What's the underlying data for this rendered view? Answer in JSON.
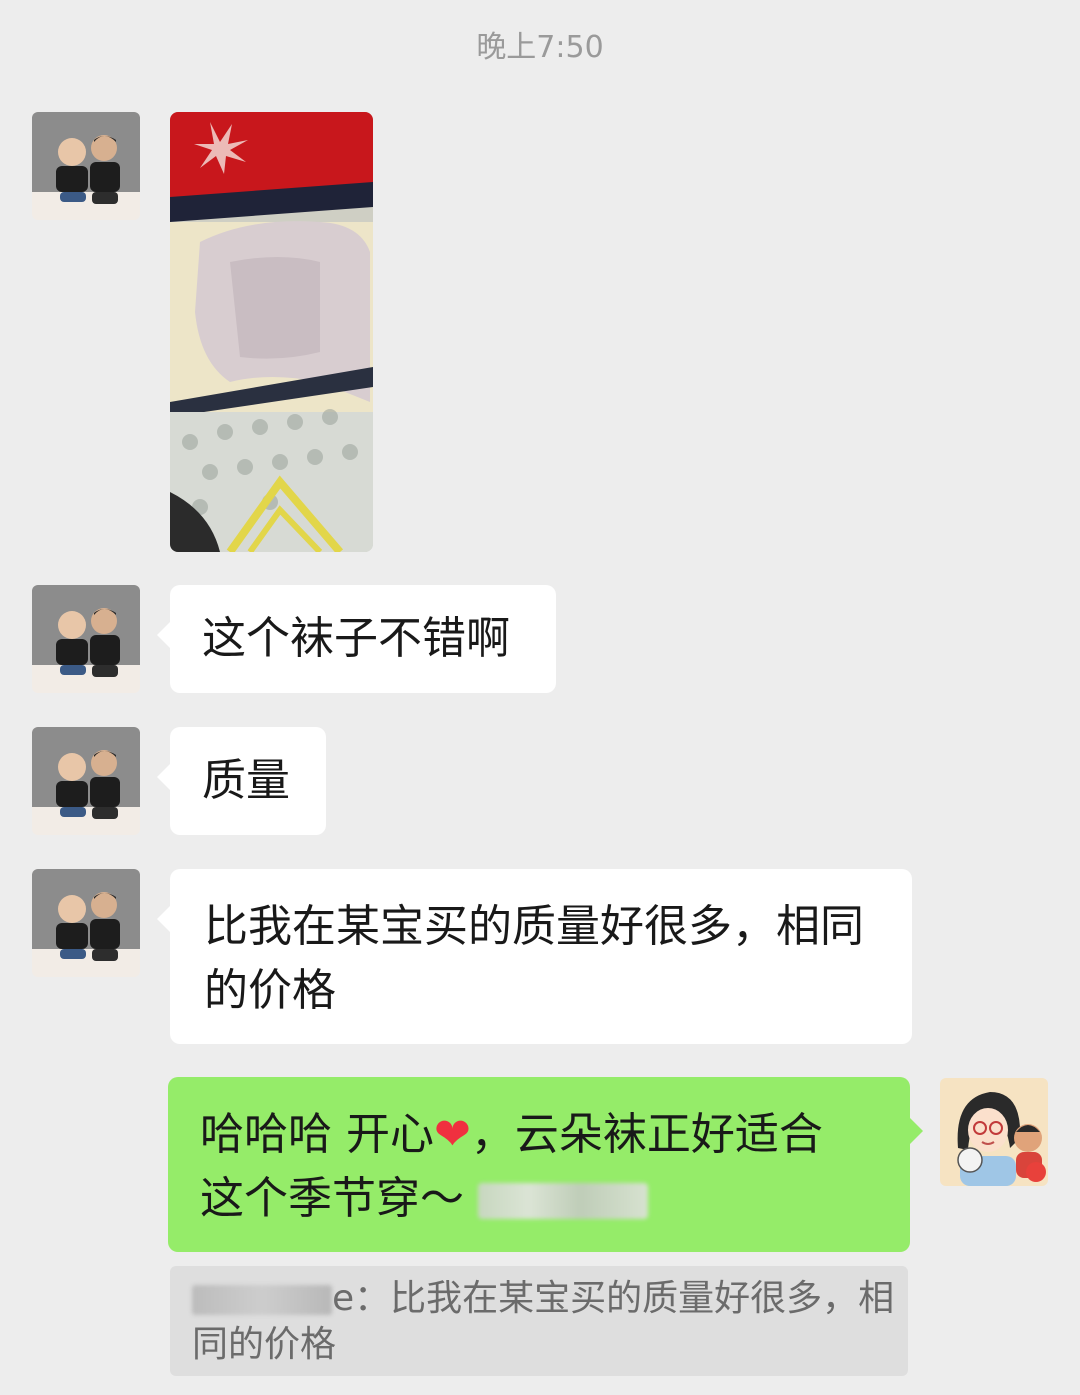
{
  "timestamp": "晚上7:50",
  "contact": {
    "avatar_icon": "two-kids-photo-icon"
  },
  "me": {
    "avatar_icon": "cartoon-woman-with-kid-icon"
  },
  "messages": [
    {
      "type": "image",
      "from": "contact",
      "photo_icon": "socks-photo-icon"
    },
    {
      "type": "text",
      "from": "contact",
      "text": "这个袜子不错啊"
    },
    {
      "type": "text",
      "from": "contact",
      "text": "质量"
    },
    {
      "type": "text",
      "from": "contact",
      "line1": "比我在某宝买的质量好很多，相同",
      "line2": "的价格"
    },
    {
      "type": "text",
      "from": "me",
      "part1": "哈哈哈 开心",
      "heart": "❤",
      "part2": "，云朵袜正好适合",
      "line2": "这个季节穿～"
    }
  ],
  "quote": {
    "suffix": "e：比我在某宝买的质量好很多，相",
    "line2": "同的价格"
  },
  "colors": {
    "background": "#ededed",
    "incoming_bubble": "#ffffff",
    "outgoing_bubble": "#95ec69",
    "timestamp_text": "#9a9a9a"
  }
}
